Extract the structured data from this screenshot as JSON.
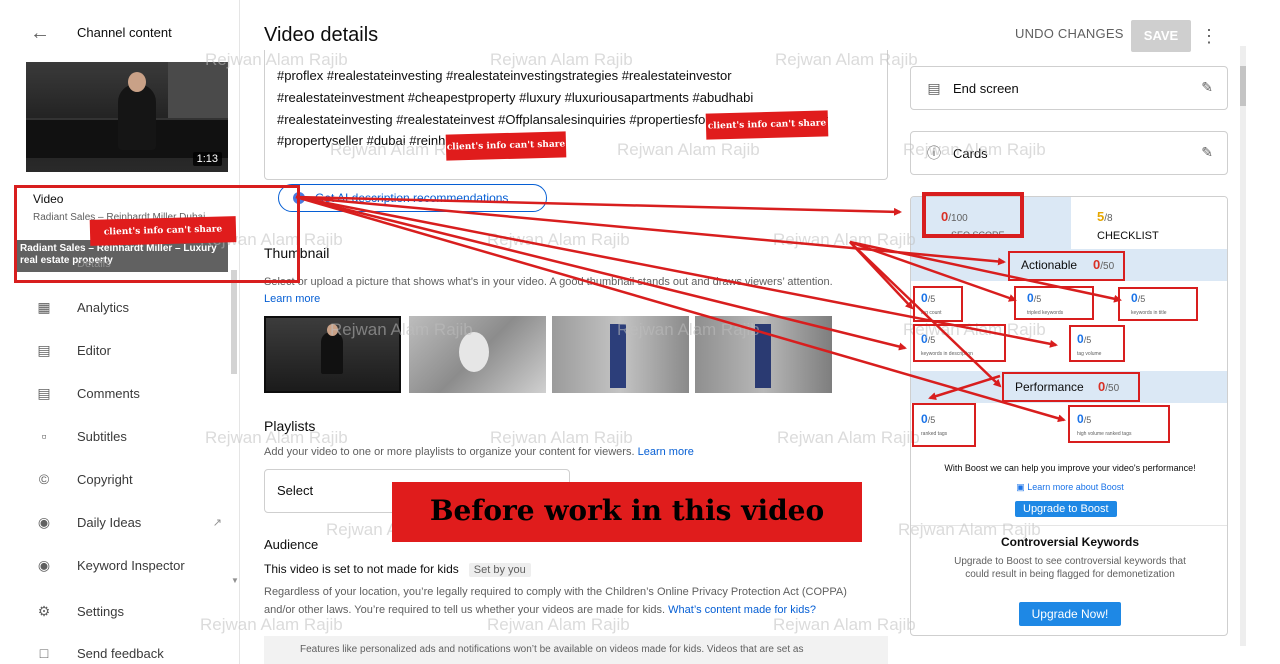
{
  "sidebar": {
    "title": "Channel content",
    "thumb_duration": "1:13",
    "video_label": "Video",
    "video_subtitle": "Radiant Sales – Reinhardt Miller Dubai",
    "tooltip": "Radiant Sales – Reinhardt Miller – Luxury real estate property",
    "details_label": "Details",
    "items": [
      {
        "label": "Analytics",
        "icon": "analytics-icon"
      },
      {
        "label": "Editor",
        "icon": "editor-icon"
      },
      {
        "label": "Comments",
        "icon": "comments-icon"
      },
      {
        "label": "Subtitles",
        "icon": "subtitles-icon"
      },
      {
        "label": "Copyright",
        "icon": "copyright-icon"
      },
      {
        "label": "Daily Ideas",
        "icon": "tubebuddy-icon"
      },
      {
        "label": "Keyword Inspector",
        "icon": "tubebuddy-icon"
      },
      {
        "label": "Settings",
        "icon": "gear-icon"
      },
      {
        "label": "Send feedback",
        "icon": "feedback-icon"
      }
    ]
  },
  "header": {
    "title": "Video details",
    "undo_label": "UNDO CHANGES",
    "save_label": "SAVE"
  },
  "description": {
    "lines": [
      "#proflex #realestateinvesting  #realestateinvestingstrategies #realestateinvestor",
      "#realestateinvestment #cheapestproperty  #luxury #luxuriousapartments #abudhabi",
      "#realestateinvesting #realestateinvest #Offplansalesinquiries #propertiesforsale #propertydealer",
      "#propertyseller #dubai  #reinhardtmiller"
    ]
  },
  "ai_button": {
    "label": "Get AI description recommendations"
  },
  "thumbnail": {
    "title": "Thumbnail",
    "desc": "Select or upload a picture that shows what’s in your video. A good thumbnail stands out and draws viewers’ attention.",
    "learn_more": "Learn more"
  },
  "playlists": {
    "title": "Playlists",
    "desc": "Add your video to one or more playlists to organize your content for viewers.",
    "learn_more": "Learn more",
    "select_value": "Select"
  },
  "audience": {
    "title": "Audience",
    "status": "This video is set to not made for kids",
    "chip": "Set by you",
    "para1": "Regardless of your location, you’re legally required to comply with the Children’s Online Privacy Protection Act (COPPA)",
    "para2": "and/or other laws. You’re required to tell us whether your videos are made for kids.",
    "para2_link": "What’s content made for kids?",
    "footer": "Features like personalized ads and notifications won’t be available on videos made for kids. Videos that are set as"
  },
  "right_panel": {
    "end_screen": "End screen",
    "cards": "Cards",
    "seo_score": "0",
    "seo_total": "/100",
    "seo_label": "SEO SCORE",
    "checklist_score": "5",
    "checklist_total": "/8",
    "checklist_label": "CHECKLIST",
    "actionable_label": "Actionable",
    "actionable_score": "0",
    "actionable_total": "/50",
    "metrics_actionable": [
      {
        "value": "0",
        "total": "/5",
        "label": "tag count"
      },
      {
        "value": "0",
        "total": "/5",
        "label": "tripled keywords"
      },
      {
        "value": "0",
        "total": "/5",
        "label": "keywords in title"
      },
      {
        "value": "0",
        "total": "/5",
        "label": "keywords in description"
      },
      {
        "value": "0",
        "total": "/5",
        "label": "tag volume"
      }
    ],
    "performance_label": "Performance",
    "performance_score": "0",
    "performance_total": "/50",
    "metrics_performance": [
      {
        "value": "0",
        "total": "/5",
        "label": "ranked tags"
      },
      {
        "value": "0",
        "total": "/5",
        "label": "high volume ranked tags"
      }
    ],
    "boost_text": "With Boost we can help you improve your video's performance!",
    "boost_link": "Learn more about Boost",
    "boost_button": "Upgrade to Boost",
    "contro_title": "Controversial Keywords",
    "contro_desc": "Upgrade to Boost to see controversial keywords that could result in being flagged for demonetization",
    "upgrade_now": "Upgrade Now!"
  },
  "annotations": {
    "censor_label": "client's info can't share",
    "banner": "Before work in this video",
    "watermark": "Rejwan Alam Rajib"
  },
  "colors": {
    "annotation_red": "#d81e1e",
    "link_blue": "#065fd4",
    "score_red": "#d93025",
    "checklist_gold": "#e6a700",
    "band_blue": "#dbe8f5"
  }
}
